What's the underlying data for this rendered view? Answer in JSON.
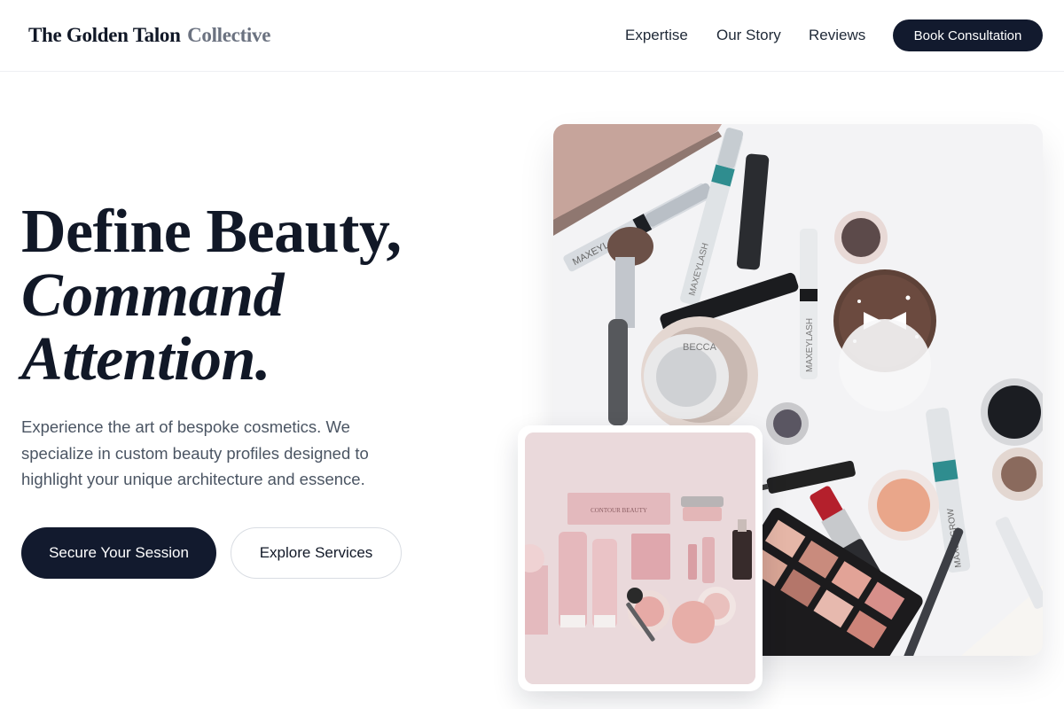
{
  "header": {
    "brand_main": "The Golden Talon",
    "brand_accent": "Collective",
    "nav": {
      "expertise": "Expertise",
      "story": "Our Story",
      "reviews": "Reviews"
    },
    "cta_label": "Book Consultation"
  },
  "hero": {
    "headline_line1": "Define Beauty,",
    "headline_line2": "Command",
    "headline_line3": "Attention.",
    "lead": "Experience the art of bespoke cosmetics. We specialize in custom beauty profiles designed to highlight your unique architecture and essence.",
    "primary_button": "Secure Your Session",
    "secondary_button": "Explore Services"
  },
  "images": {
    "main_text": {
      "mascara_1": "MAXEYLASH",
      "mascara_2": "MAXEYLASH",
      "mascara_3": "MAXEYLASH",
      "mascara_4": "MAXEYGROW",
      "compact": "BECCA"
    },
    "small_text": {
      "box": "CONTOUR BEAUTY"
    }
  },
  "colors": {
    "primary_dark": "#121a2e",
    "muted_text": "#4b5563",
    "brand_accent": "#6b7280"
  }
}
